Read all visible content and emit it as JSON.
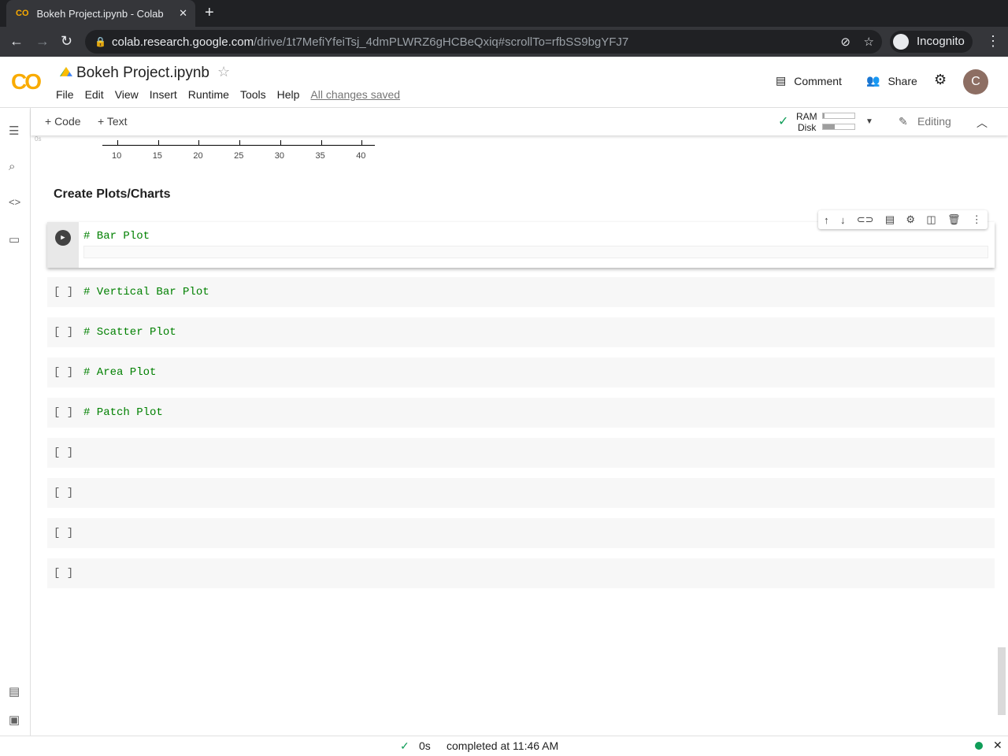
{
  "browser": {
    "tab_title": "Bokeh Project.ipynb - Colab",
    "url_host": "colab.research.google.com",
    "url_path": "/drive/1t7MefiYfeiTsj_4dmPLWRZ6gHCBeQxiq#scrollTo=rfbSS9bgYFJ7",
    "profile": "Incognito"
  },
  "header": {
    "logo": "CO",
    "title": "Bokeh Project.ipynb",
    "menu": [
      "File",
      "Edit",
      "View",
      "Insert",
      "Runtime",
      "Tools",
      "Help"
    ],
    "saved": "All changes saved",
    "comment": "Comment",
    "share": "Share",
    "avatar": "C"
  },
  "toolbar": {
    "add_code": "+ Code",
    "add_text": "+ Text",
    "ram_label": "RAM",
    "disk_label": "Disk",
    "ram_pct": 5,
    "disk_pct": 38,
    "editing": "Editing"
  },
  "output_axis": {
    "ticks": [
      "10",
      "15",
      "20",
      "25",
      "30",
      "35",
      "40"
    ],
    "gutter": "0s"
  },
  "section_title": "Create Plots/Charts",
  "cells": [
    {
      "bracket": "",
      "code": "# Bar Plot"
    },
    {
      "bracket": "[ ]",
      "code": "# Vertical Bar Plot"
    },
    {
      "bracket": "[ ]",
      "code": "# Scatter Plot"
    },
    {
      "bracket": "[ ]",
      "code": "# Area Plot"
    },
    {
      "bracket": "[ ]",
      "code": "# Patch Plot"
    },
    {
      "bracket": "[ ]",
      "code": ""
    },
    {
      "bracket": "[ ]",
      "code": ""
    },
    {
      "bracket": "[ ]",
      "code": ""
    },
    {
      "bracket": "[ ]",
      "code": ""
    }
  ],
  "status": {
    "time": "0s",
    "message": "completed at 11:46 AM"
  }
}
